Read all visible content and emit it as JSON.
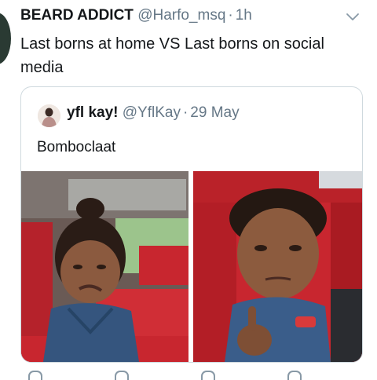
{
  "tweet": {
    "author_name": "BEARD ADDICT",
    "author_handle": "@Harfo_msq",
    "separator": "·",
    "time": "1h",
    "text": "Last borns at home VS Last borns on social media"
  },
  "quoted_tweet": {
    "author_name": "yfl kay!",
    "author_handle": "@YflKay",
    "separator": "·",
    "date": "29 May",
    "text": "Bomboclaat",
    "photos": [
      "crying-toddler-photo",
      "unimpressed-toddler-photo"
    ]
  },
  "colors": {
    "text_primary": "#14171a",
    "text_secondary": "#657786",
    "card_border": "#cfd9de",
    "car_seat_red": "#c8262f"
  },
  "icons": [
    "chevron-down-icon",
    "reply-icon",
    "retweet-icon",
    "like-icon",
    "share-icon"
  ]
}
